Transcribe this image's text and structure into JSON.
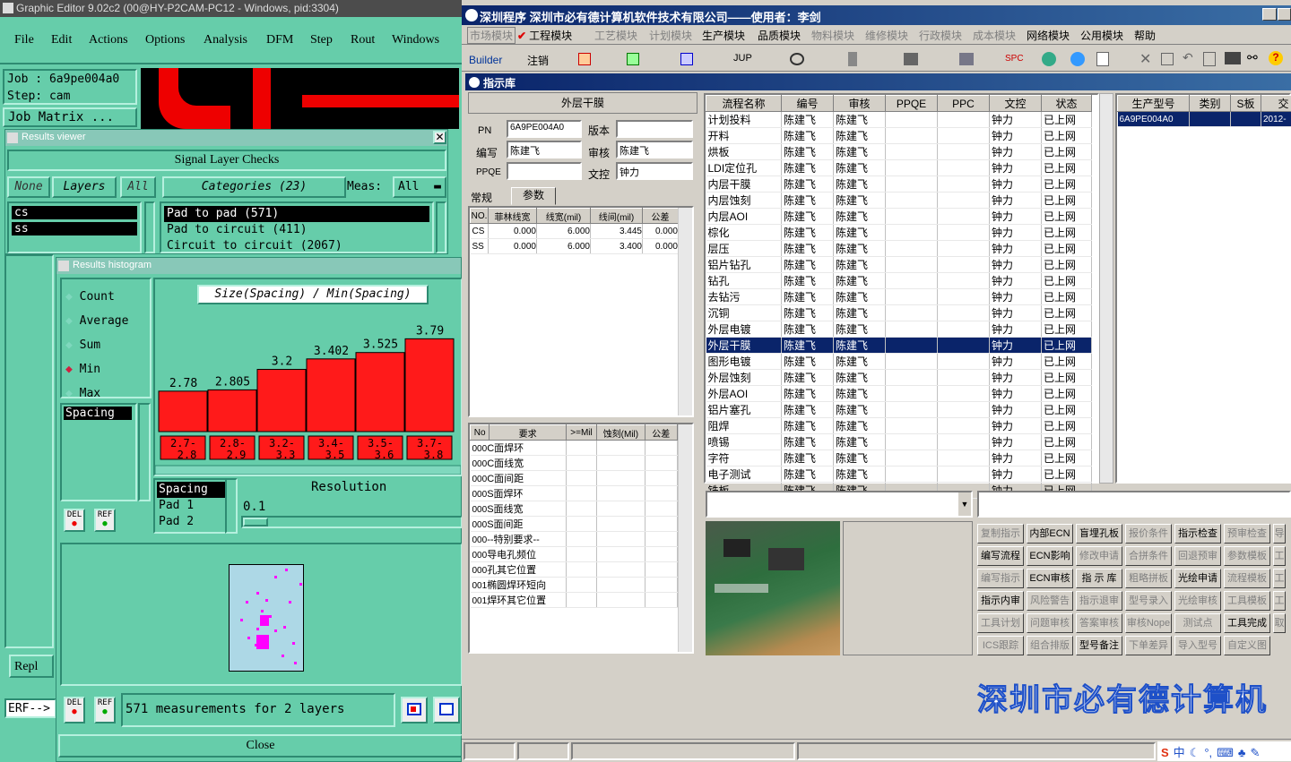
{
  "left": {
    "title": "Graphic Editor 9.02c2 (00@HY-P2CAM-PC12 - Windows, pid:3304)",
    "menu": [
      "File",
      "Edit",
      "Actions",
      "Options",
      "Analysis",
      "DFM",
      "Step",
      "Rout",
      "Windows"
    ],
    "job": "Job : 6a9pe004a0",
    "step": "Step: cam",
    "job_matrix": "Job Matrix ...",
    "results_viewer": {
      "title": "Results viewer",
      "header": "Signal Layer Checks",
      "none": "None",
      "layers": "Layers",
      "all": "All",
      "categories": "Categories (23)",
      "meas": "Meas:",
      "meas_val": "All",
      "layer_list": [
        "cs",
        "ss"
      ],
      "cat_list": [
        "Pad to pad (571)",
        "Pad to circuit (411)",
        "Circuit to circuit (2067)"
      ]
    },
    "histogram": {
      "title": "Results histogram",
      "options": [
        "Count",
        "Average",
        "Sum",
        "Min",
        "Max"
      ],
      "selected": "Min",
      "chart_title": "Size(Spacing) / Min(Spacing)",
      "spacing_list": [
        "Spacing"
      ],
      "del": "DEL",
      "ref": "REF",
      "spacing2": [
        "Spacing",
        "Pad 1",
        "Pad 2"
      ],
      "resolution": "Resolution",
      "resolution_val": "0.1",
      "status": "571 measurements for 2 layers",
      "close": "Close"
    },
    "repl": "Repl",
    "erf": "ERF-->"
  },
  "chart_data": {
    "type": "bar",
    "title": "Size(Spacing) / Min(Spacing)",
    "categories": [
      "2.7-2.8",
      "2.8-2.9",
      "3.2-3.3",
      "3.4-3.5",
      "3.5-3.6",
      "3.7-3.8"
    ],
    "values": [
      2.78,
      2.805,
      3.2,
      3.402,
      3.525,
      3.79
    ],
    "value_labels": [
      "2.78",
      "2.805",
      "3.2",
      "3.402",
      "3.525",
      "3.79"
    ],
    "cat_top": [
      "2.7-",
      "2.8-",
      "3.2-",
      "3.4-",
      "3.5-",
      "3.7-"
    ],
    "cat_bot": [
      "2.8",
      "2.9",
      "3.3",
      "3.5",
      "3.6",
      "3.8"
    ],
    "ylim": [
      2.0,
      3.9
    ],
    "colors": {
      "bar": "#ff1a1a"
    }
  },
  "right": {
    "title": "深圳程序   深圳市必有德计算机软件技术有限公司——使用者：李剑",
    "modules": [
      "市场模块",
      "工程模块",
      "工艺模块",
      "计划模块",
      "生产模块",
      "品质模块",
      "物料模块",
      "维修模块",
      "行政模块",
      "成本模块",
      "网络模块",
      "公用模块",
      "帮助"
    ],
    "module_enabled": [
      false,
      true,
      false,
      false,
      true,
      true,
      false,
      false,
      false,
      false,
      true,
      true,
      true
    ],
    "toolbar": {
      "builder": "Builder",
      "logout": "注销",
      "jup": "JUP",
      "spc": "SPC"
    },
    "panel_title": "指示库",
    "proc_name": "外层干膜",
    "form": {
      "pn_label": "PN",
      "pn": "6A9PE004A0",
      "version_label": "版本",
      "version": "",
      "author_label": "编写",
      "author": "陈建飞",
      "review_label": "审核",
      "review": "陈建飞",
      "ppqe_label": "PPQE",
      "ppqe": "",
      "doc_label": "文控",
      "doc": "钟力"
    },
    "tabs": [
      "常规",
      "参数"
    ],
    "param_table": {
      "headers": [
        "NO.",
        "菲林线宽",
        "线宽(mil)",
        "线间(mil)",
        "公差"
      ],
      "rows": [
        [
          "CS",
          "0.000",
          "6.000",
          "3.445",
          "0.000"
        ],
        [
          "SS",
          "0.000",
          "6.000",
          "3.400",
          "0.000"
        ]
      ]
    },
    "req_table": {
      "headers": [
        "No",
        "要求",
        ">=Mil",
        "蚀刻(Mil)",
        "公差"
      ],
      "rows": [
        [
          "000",
          "C面焊环"
        ],
        [
          "000",
          "C面线宽"
        ],
        [
          "000",
          "C面间距"
        ],
        [
          "000",
          "S面焊环"
        ],
        [
          "000",
          "S面线宽"
        ],
        [
          "000",
          "S面间距"
        ],
        [
          "000",
          "--特别要求--"
        ],
        [
          "000",
          "导电孔频位"
        ],
        [
          "000",
          "孔其它位置"
        ],
        [
          "001",
          "椭圆焊环短向"
        ],
        [
          "001",
          "焊环其它位置"
        ]
      ]
    },
    "flow_table": {
      "headers": [
        "流程名称",
        "编号",
        "审核",
        "PPQE",
        "PPC",
        "文控",
        "状态"
      ],
      "rows": [
        "计划投料",
        "开料",
        "烘板",
        "LDI定位孔",
        "内层干膜",
        "内层蚀刻",
        "内层AOI",
        "棕化",
        "层压",
        "铝片钻孔",
        "钻孔",
        "去钻污",
        "沉铜",
        "外层电镀",
        "外层干膜",
        "图形电镀",
        "外层蚀刻",
        "外层AOI",
        "铝片塞孔",
        "阻焊",
        "喷锡",
        "字符",
        "电子测试",
        "铣板"
      ],
      "author": "陈建飞",
      "doc": "钟力",
      "status": "已上网",
      "selected_index": 14
    },
    "model_table": {
      "headers": [
        "生产型号",
        "类别",
        "S板",
        "交"
      ],
      "row": [
        "6A9PE004A0",
        "",
        "",
        "2012-"
      ]
    },
    "func_buttons": [
      [
        "复制指示",
        "内部ECN",
        "盲埋孔板",
        "报价条件",
        "指示检查",
        "预审检查",
        "导"
      ],
      [
        "编写流程",
        "ECN影响",
        "修改申请",
        "合拼条件",
        "回退预审",
        "参数模板",
        "工"
      ],
      [
        "编写指示",
        "ECN审核",
        "指 示 库",
        "粗略拼板",
        "光绘申请",
        "流程模板",
        "工"
      ],
      [
        "指示内审",
        "风险警告",
        "指示退审",
        "型号录入",
        "光绘审核",
        "工具模板",
        "工"
      ],
      [
        "工具计划",
        "问题审核",
        "答案审核",
        "审核Nope",
        "测试点",
        "工具完成",
        "取"
      ],
      [
        "ICS跟踪",
        "组合排版",
        "型号备注",
        "下单差异",
        "导入型号",
        "自定义图",
        ""
      ]
    ],
    "func_enabled": [
      [
        false,
        true,
        true,
        false,
        true,
        false,
        false
      ],
      [
        true,
        true,
        false,
        false,
        false,
        false,
        false
      ],
      [
        false,
        true,
        true,
        false,
        true,
        false,
        false
      ],
      [
        true,
        false,
        false,
        false,
        false,
        false,
        false
      ],
      [
        false,
        false,
        false,
        false,
        false,
        true,
        false
      ],
      [
        false,
        false,
        true,
        false,
        false,
        false,
        false
      ]
    ],
    "banner": "深圳市必有德计算机",
    "tray": [
      "S",
      "中",
      "☾",
      "°,",
      "⌨",
      "♣",
      "✎"
    ]
  }
}
